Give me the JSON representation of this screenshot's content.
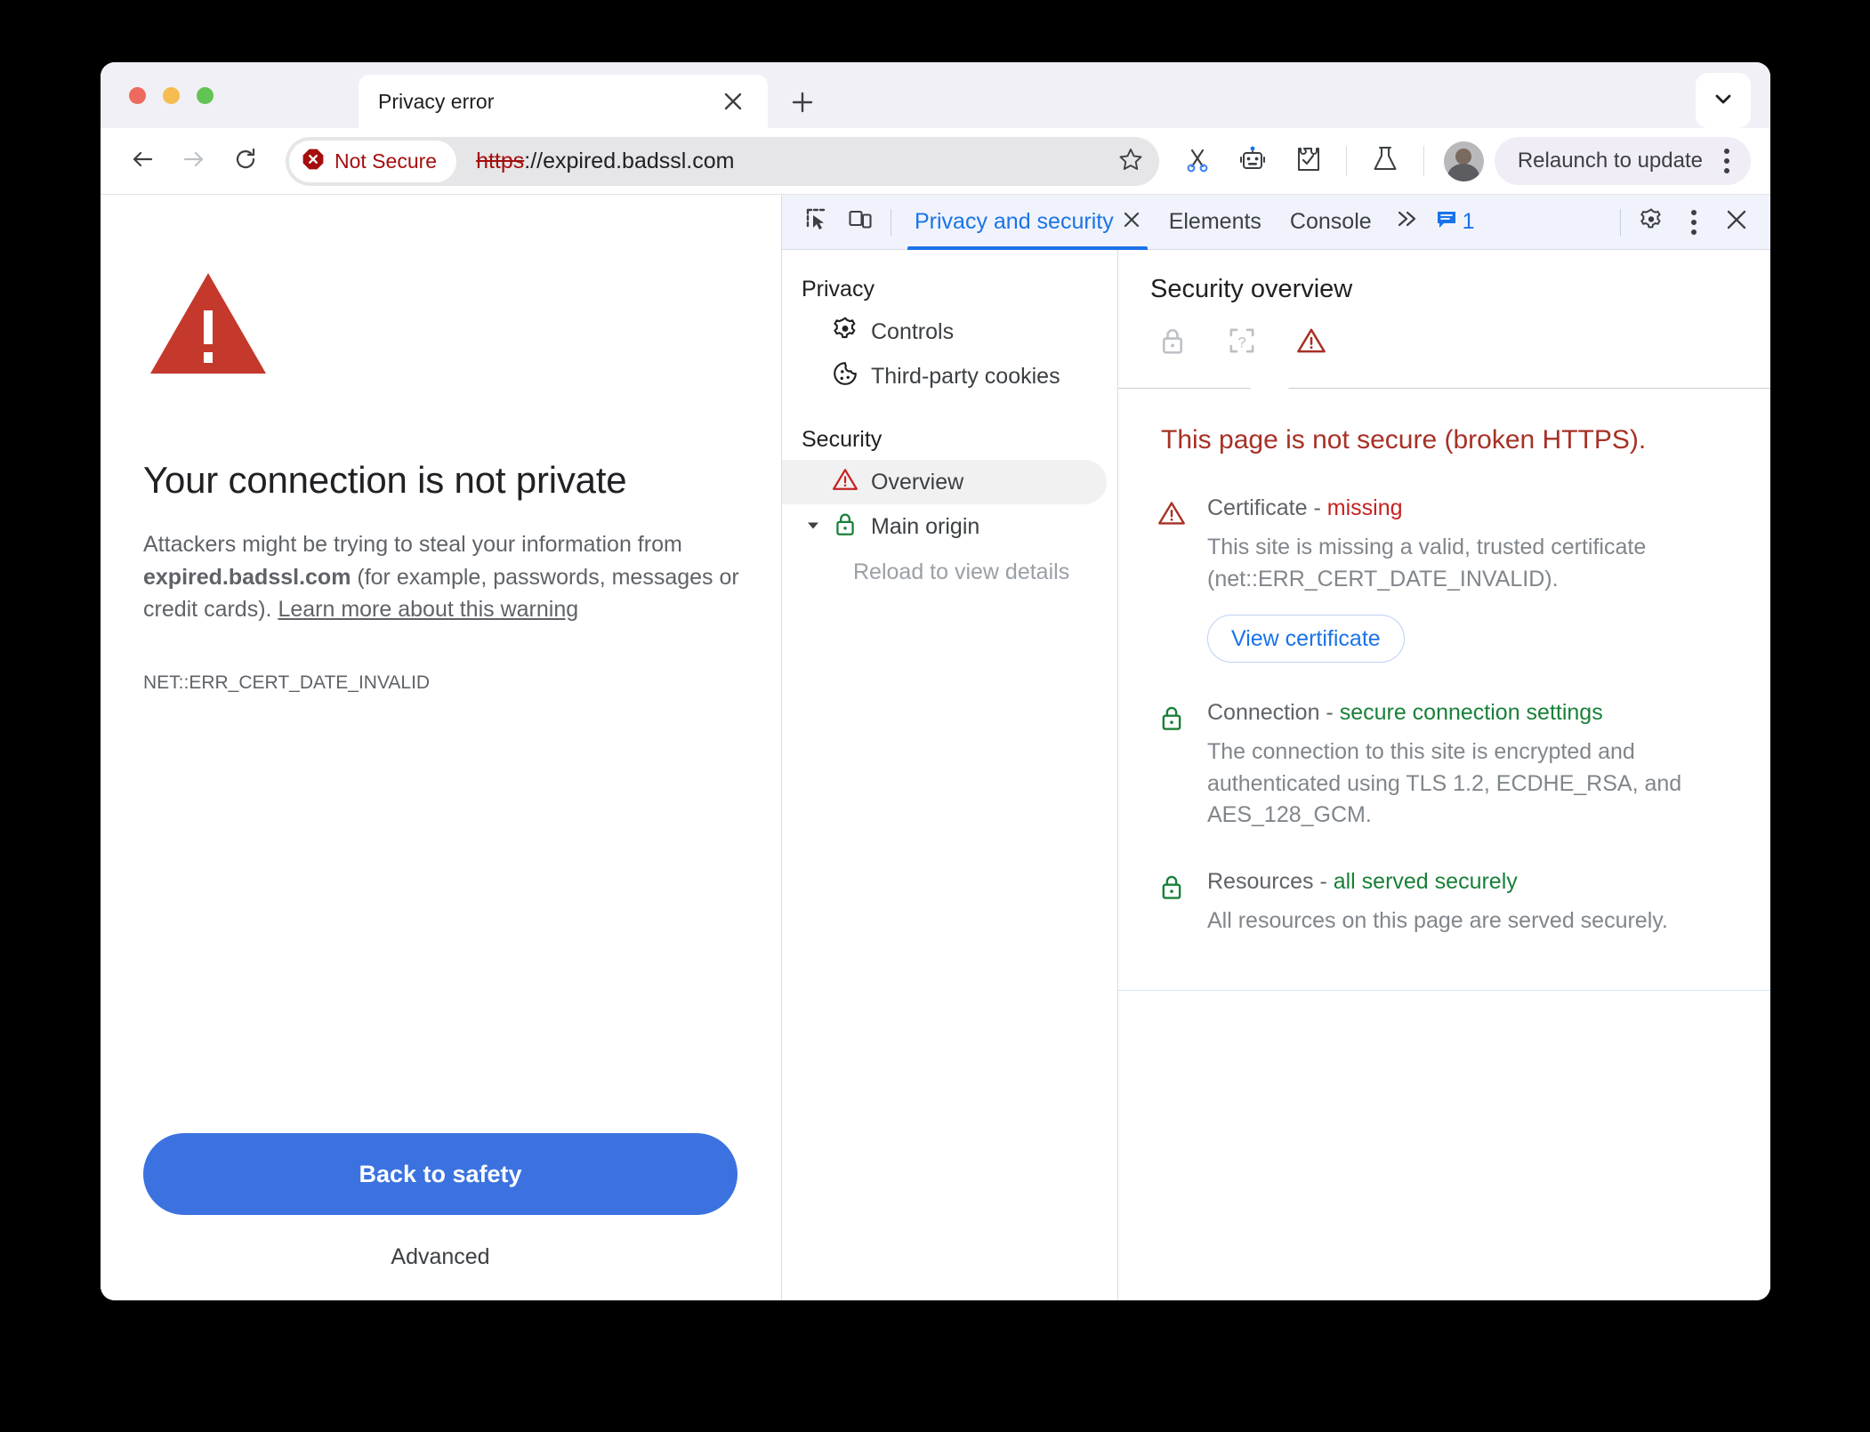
{
  "window": {
    "traffic_lights": [
      "close",
      "minimize",
      "maximize"
    ]
  },
  "tabstrip": {
    "tab_title": "Privacy error",
    "close_label": "✕",
    "new_tab_label": "+",
    "tab_search_icon": "chevron-down-icon"
  },
  "toolbar": {
    "back_icon": "back-arrow-icon",
    "forward_icon": "forward-arrow-icon",
    "reload_icon": "reload-icon",
    "security_badge": "Not Secure",
    "url_scheme": "https",
    "url_rest": "://expired.badssl.com",
    "bookmark_icon": "star-icon",
    "icons": [
      "scissors-icon",
      "robot-icon",
      "extension-icon",
      "flask-icon"
    ],
    "profile_icon": "avatar",
    "relaunch_label": "Relaunch to update",
    "menu_icon": "kebab-menu-icon"
  },
  "page": {
    "warning_icon": "warning-triangle-icon",
    "heading": "Your connection is not private",
    "body_part1": "Attackers might be trying to steal your information from ",
    "body_host": "expired.badssl.com",
    "body_part2": " (for example, passwords, messages or credit cards). ",
    "learn_more": "Learn more about this warning",
    "error_code": "NET::ERR_CERT_DATE_INVALID",
    "primary_button": "Back to safety",
    "advanced_button": "Advanced"
  },
  "devtools": {
    "inspect_icon": "inspect-element-icon",
    "device_icon": "device-toolbar-icon",
    "tabs": [
      {
        "label": "Privacy and security",
        "active": true,
        "closable": true
      },
      {
        "label": "Elements",
        "active": false,
        "closable": false
      },
      {
        "label": "Console",
        "active": false,
        "closable": false
      }
    ],
    "more_tabs_icon": "chevron-right-double-icon",
    "issues_icon": "issues-icon",
    "issues_count": "1",
    "settings_icon": "gear-icon",
    "menu_icon": "kebab-menu-icon",
    "close_icon": "close-icon",
    "sidebar": {
      "groups": [
        {
          "title": "Privacy",
          "items": [
            {
              "label": "Controls",
              "icon": "gear-icon",
              "selected": false
            },
            {
              "label": "Third-party cookies",
              "icon": "cookie-icon",
              "selected": false
            }
          ]
        },
        {
          "title": "Security",
          "items": [
            {
              "label": "Overview",
              "icon": "warning-triangle-icon",
              "selected": true
            },
            {
              "label": "Main origin",
              "icon": "lock-icon",
              "selected": false,
              "expandable": true
            }
          ]
        }
      ],
      "subtext": "Reload to view details"
    },
    "security": {
      "title": "Security overview",
      "state_icons": [
        {
          "name": "lock-icon",
          "state": "inactive"
        },
        {
          "name": "unknown-bracket-icon",
          "state": "inactive"
        },
        {
          "name": "warning-triangle-icon",
          "state": "active"
        }
      ],
      "summary": "This page is not secure (broken HTTPS).",
      "blocks": [
        {
          "icon": "warning-triangle-icon",
          "icon_state": "bad",
          "label": "Certificate - ",
          "value": "missing",
          "value_state": "bad",
          "description": "This site is missing a valid, trusted certificate (net::ERR_CERT_DATE_INVALID).",
          "button": "View certificate"
        },
        {
          "icon": "lock-icon",
          "icon_state": "good",
          "label": "Connection - ",
          "value": "secure connection settings",
          "value_state": "good",
          "description": "The connection to this site is encrypted and authenticated using TLS 1.2, ECDHE_RSA, and AES_128_GCM."
        },
        {
          "icon": "lock-icon",
          "icon_state": "good",
          "label": "Resources - ",
          "value": "all served securely",
          "value_state": "good",
          "description": "All resources on this page are served securely."
        }
      ]
    }
  },
  "colors": {
    "accent_blue": "#1a73e8",
    "danger_red": "#c5221f",
    "warn_red": "#a73126",
    "success_green": "#188038",
    "button_blue": "#3b72e0"
  }
}
